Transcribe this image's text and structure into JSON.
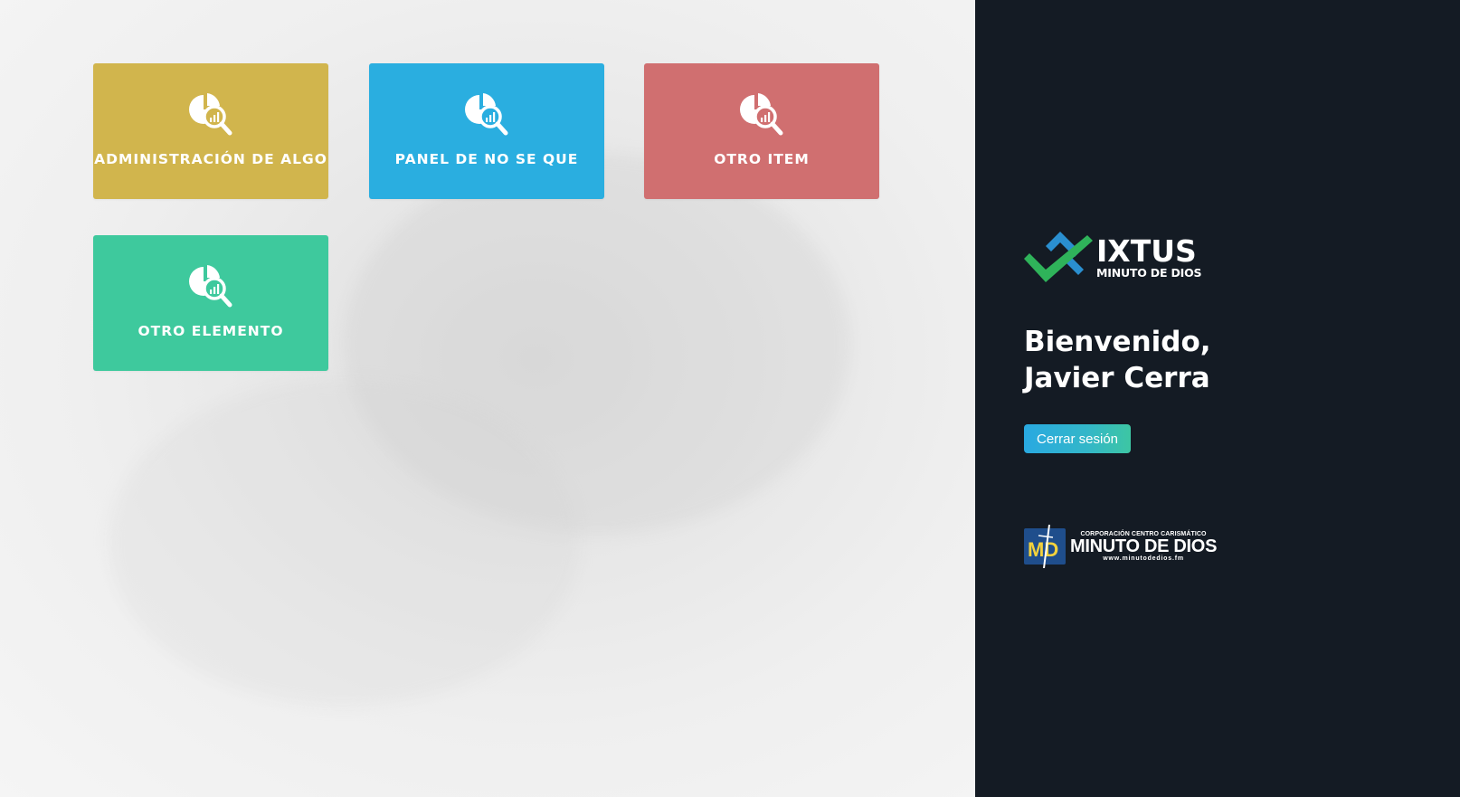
{
  "tiles": [
    {
      "label": "ADMINISTRACIÓN DE ALGO",
      "color": "#d1b54d",
      "icon": "analytics-search-icon"
    },
    {
      "label": "PANEL DE NO SE QUE",
      "color": "#2aaee0",
      "icon": "analytics-search-icon"
    },
    {
      "label": "OTRO ITEM",
      "color": "#d06f70",
      "icon": "analytics-search-icon"
    },
    {
      "label": "OTRO ELEMENTO",
      "color": "#3ec99d",
      "icon": "analytics-search-icon"
    }
  ],
  "sidebar": {
    "background": "#141b24",
    "brand": {
      "name": "IXTUS",
      "subtitle": "MINUTO DE DIOS",
      "mark_colors": [
        "#2a8fd0",
        "#2fb35a"
      ]
    },
    "welcome_line1": "Bienvenido,",
    "welcome_line2": "Javier Cerra",
    "logout_label": "Cerrar sesión",
    "org": {
      "top": "CORPORACIÓN CENTRO CARISMÁTICO",
      "name": "MINUTO DE DIOS",
      "url": "www.minutodedios.fm",
      "mark_text": "MD",
      "mark_color": "#1f4e8c",
      "accent_color": "#f3d23c"
    }
  }
}
